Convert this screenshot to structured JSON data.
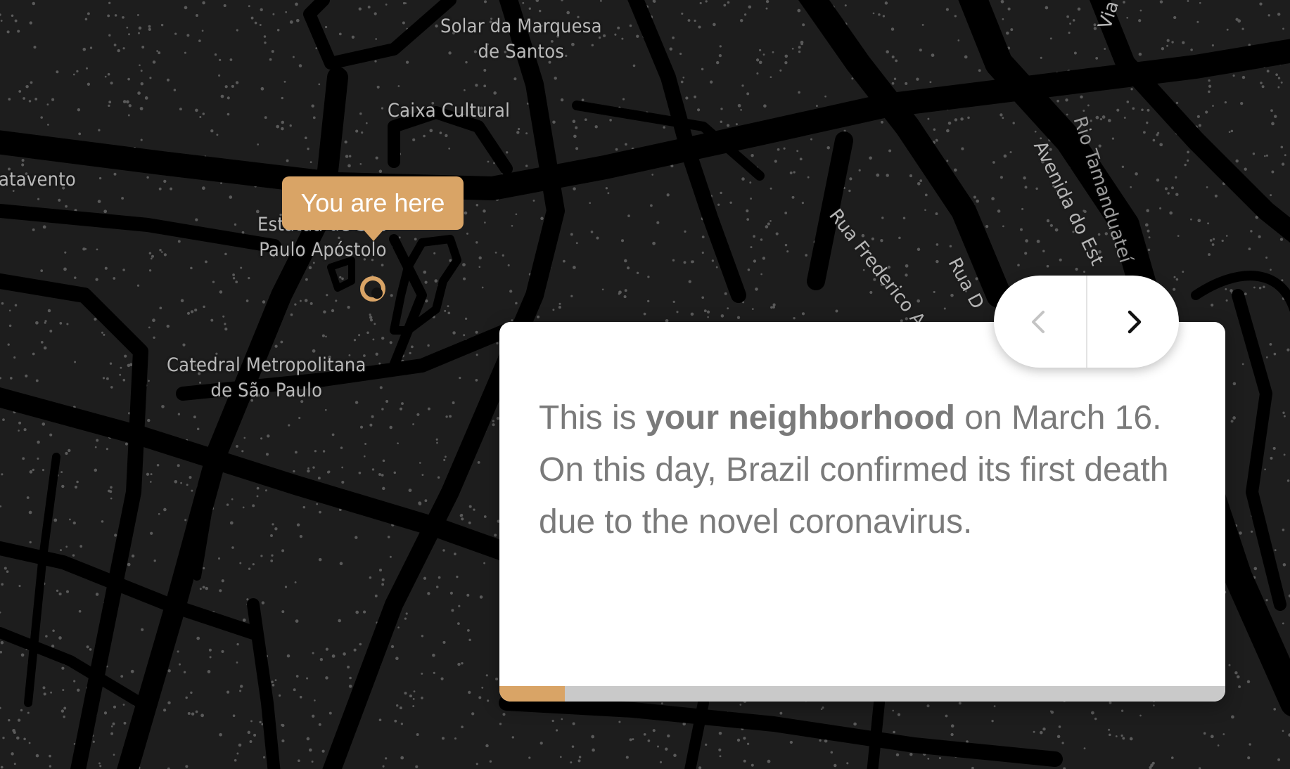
{
  "colors": {
    "map_background": "#1d1d1d",
    "road": "#000000",
    "building_dots": "#5a5a5a",
    "accent": "#d9a466",
    "card_background": "#ffffff",
    "text": "#7a7a7a",
    "progress_track": "#c9c9c9",
    "nav_disabled": "#c4c4c4",
    "nav_enabled": "#111111"
  },
  "map": {
    "places": [
      {
        "id": "solar-da-marquesa",
        "lines": [
          "Solar da Marquesa",
          "de Santos"
        ]
      },
      {
        "id": "caixa-cultural",
        "lines": [
          "Caixa Cultural"
        ]
      },
      {
        "id": "catavento",
        "lines": [
          "atavento"
        ]
      },
      {
        "id": "estatua",
        "lines": [
          "Estátua de São",
          "Paulo Apóstolo"
        ]
      },
      {
        "id": "catedral",
        "lines": [
          "Catedral Metropolitana",
          "de São Paulo"
        ]
      }
    ],
    "streets": [
      {
        "id": "rua-frederico",
        "text": "Rua Frederico A"
      },
      {
        "id": "rua-d",
        "text": "Rua D"
      },
      {
        "id": "avenida-do-estado",
        "text": "Avenida do Est"
      },
      {
        "id": "rio-tamanduatei",
        "text": "Rio Tamanduateí"
      },
      {
        "id": "via",
        "text": "Via"
      }
    ],
    "you_are_here": "You are here",
    "location_marker_icon": "location-pin-icon"
  },
  "story": {
    "text_before": "This is ",
    "text_bold": "your neighborhood",
    "text_after": " on March 16. On this day, Brazil confirmed its first death due to the novel coronavirus.",
    "progress_fraction": 0.09
  },
  "navigation": {
    "prev_icon": "chevron-left-icon",
    "next_icon": "chevron-right-icon",
    "prev_enabled": false,
    "next_enabled": true
  }
}
